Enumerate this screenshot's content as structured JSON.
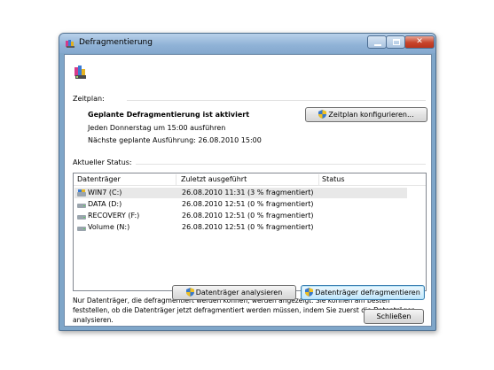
{
  "window": {
    "title": "Defragmentierung"
  },
  "schedule": {
    "section_label": "Zeitplan:",
    "status": "Geplante Defragmentierung ist aktiviert",
    "frequency": "Jeden Donnerstag um 15:00 ausführen",
    "next_run": "Nächste geplante Ausführung: 26.08.2010 15:00",
    "configure_button": "Zeitplan konfigurieren..."
  },
  "current_status": {
    "section_label": "Aktueller Status:",
    "columns": [
      "Datenträger",
      "Zuletzt ausgeführt",
      "Status"
    ],
    "rows": [
      {
        "drive": "WIN7 (C:)",
        "last_run": "26.08.2010 11:31 (3 % fragmentiert)",
        "status": ""
      },
      {
        "drive": "DATA (D:)",
        "last_run": "26.08.2010 12:51 (0 % fragmentiert)",
        "status": ""
      },
      {
        "drive": "RECOVERY (F:)",
        "last_run": "26.08.2010 12:51 (0 % fragmentiert)",
        "status": ""
      },
      {
        "drive": "Volume (N:)",
        "last_run": "26.08.2010 12:51 (0 % fragmentiert)",
        "status": ""
      }
    ]
  },
  "footer": {
    "info_text": "Nur Datenträger, die defragmentiert werden können, werden angezeigt. Sie können am besten feststellen, ob die Datenträger jetzt defragmentiert werden müssen, indem Sie zuerst die Datenträger analysieren.",
    "analyze_button": "Datenträger analysieren",
    "defrag_button": "Datenträger defragmentieren",
    "close_button": "Schließen"
  },
  "icons": {
    "app": "defragmenter-icon",
    "system_drive": "system-drive-icon",
    "drive": "drive-icon",
    "uac_shield": "uac-shield-icon"
  },
  "colors": {
    "titlebar": "#8fb2d6",
    "close_button": "#c7442b",
    "selection": "#e8e8e8"
  }
}
